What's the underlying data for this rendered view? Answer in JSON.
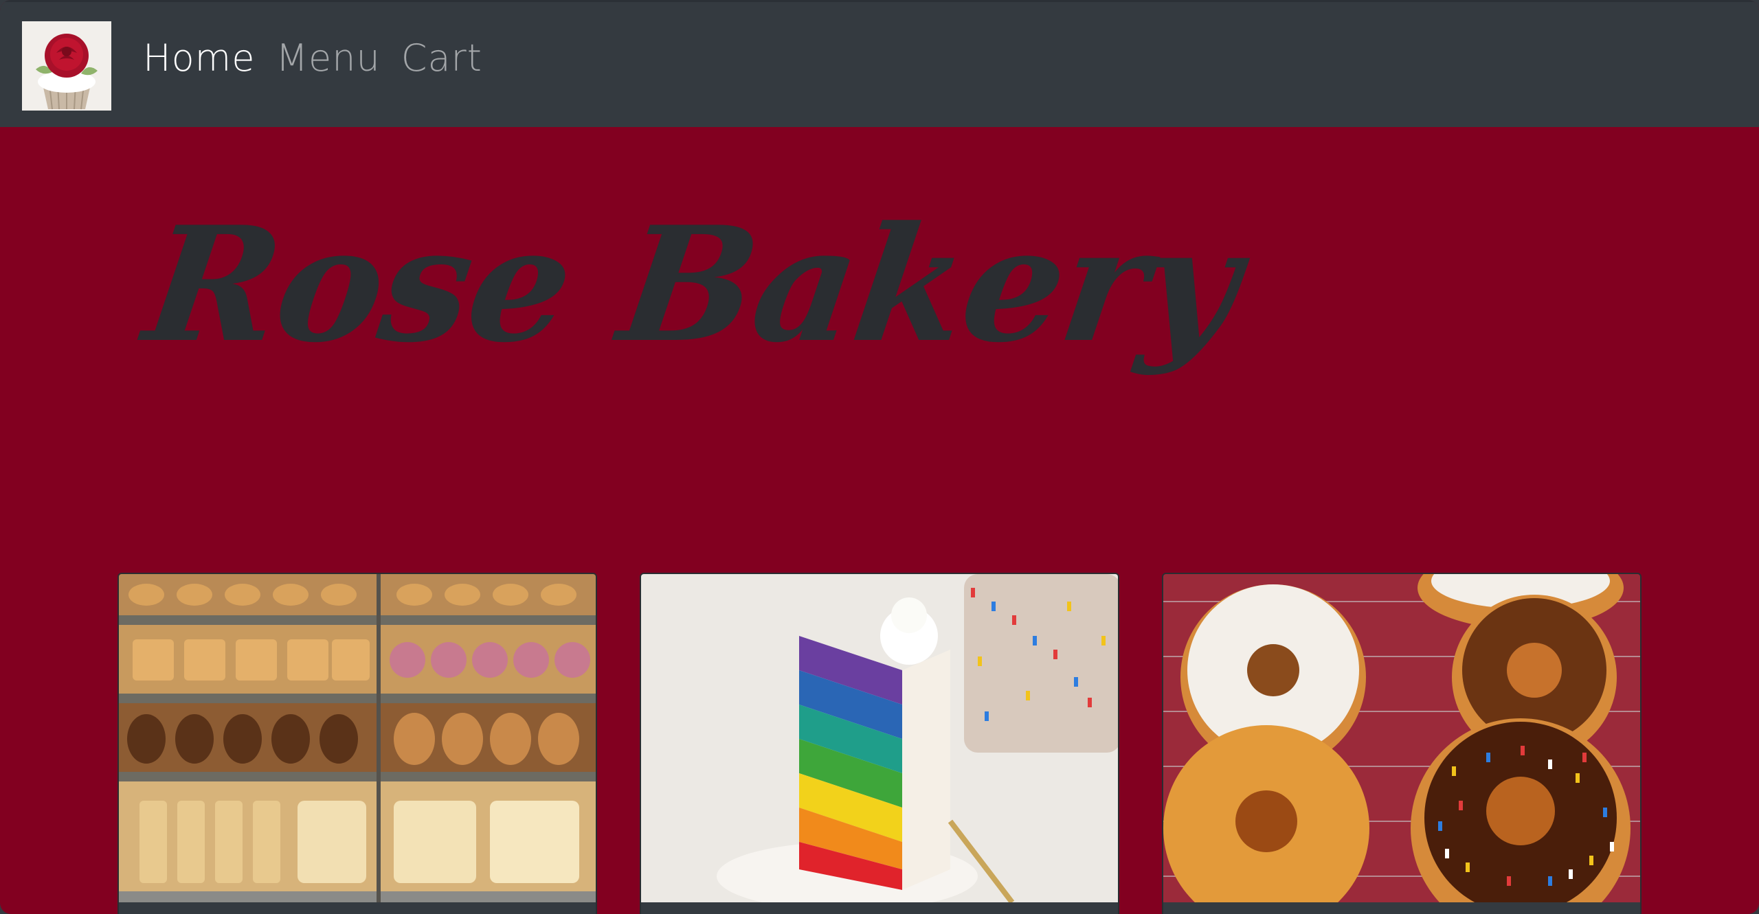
{
  "navbar": {
    "logo_icon": "rose-cupcake-logo",
    "links": [
      {
        "label": "Home",
        "active": true
      },
      {
        "label": "Menu",
        "active": false
      },
      {
        "label": "Cart",
        "active": false
      }
    ]
  },
  "hero": {
    "title": "Rose Bakery"
  },
  "cards": [
    {
      "image": "bakery-display-case-image"
    },
    {
      "image": "rainbow-layer-cake-image"
    },
    {
      "image": "donuts-on-rack-image"
    }
  ],
  "colors": {
    "navbar_bg": "#343a40",
    "hero_bg": "#820020",
    "title_color": "#2a2d31",
    "nav_active": "#ffffff",
    "nav_inactive": "#9a9da0"
  }
}
